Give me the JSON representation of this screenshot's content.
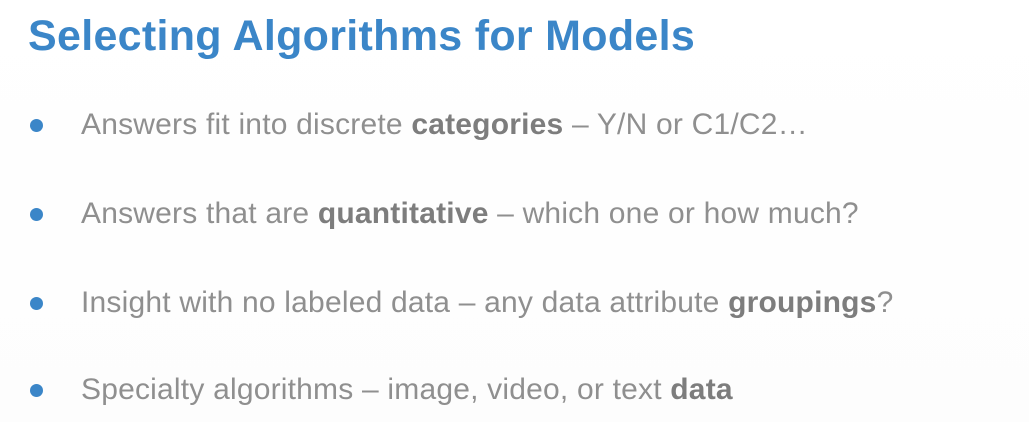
{
  "slide": {
    "title": "Selecting Algorithms for Models",
    "accent_color": "#3b86c8",
    "text_color": "#8f8f8f",
    "bullets": [
      {
        "before": "Answers fit into discrete ",
        "bold": "categories",
        "after": " – Y/N or C1/C2…"
      },
      {
        "before": "Answers that are ",
        "bold": "quantitative",
        "after": " – which one or how much?"
      },
      {
        "before": "Insight with no labeled data – any data attribute ",
        "bold": "groupings",
        "after": "?"
      },
      {
        "before": "Specialty algorithms – image, video, or text ",
        "bold": "data",
        "after": ""
      }
    ]
  }
}
